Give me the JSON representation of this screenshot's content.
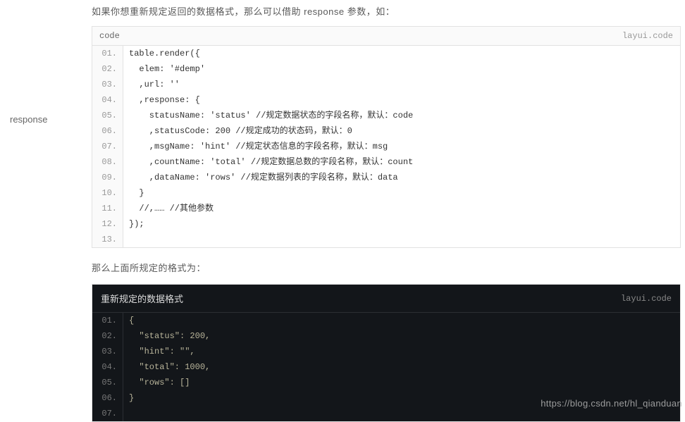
{
  "sidebar": {
    "label": "response"
  },
  "intro": "如果你想重新规定返回的数据格式，那么可以借助 response 参数，如：",
  "block1": {
    "title": "code",
    "badge": "layui.code",
    "lines": [
      "table.render({",
      "  elem: '#demp'",
      "  ,url: ''",
      "  ,response: {",
      "    statusName: 'status' //规定数据状态的字段名称，默认：code",
      "    ,statusCode: 200 //规定成功的状态码，默认：0",
      "    ,msgName: 'hint' //规定状态信息的字段名称，默认：msg",
      "    ,countName: 'total' //规定数据总数的字段名称，默认：count",
      "    ,dataName: 'rows' //规定数据列表的字段名称，默认：data",
      "  }",
      "  //,…… //其他参数",
      "});",
      ""
    ]
  },
  "midtext": "那么上面所规定的格式为：",
  "block2": {
    "title": "重新规定的数据格式",
    "badge": "layui.code",
    "lines": [
      "{",
      "  \"status\": 200,",
      "  \"hint\": \"\",",
      "  \"total\": 1000,",
      "  \"rows\": []",
      "}",
      ""
    ]
  },
  "watermark": "https://blog.csdn.net/hl_qianduan"
}
